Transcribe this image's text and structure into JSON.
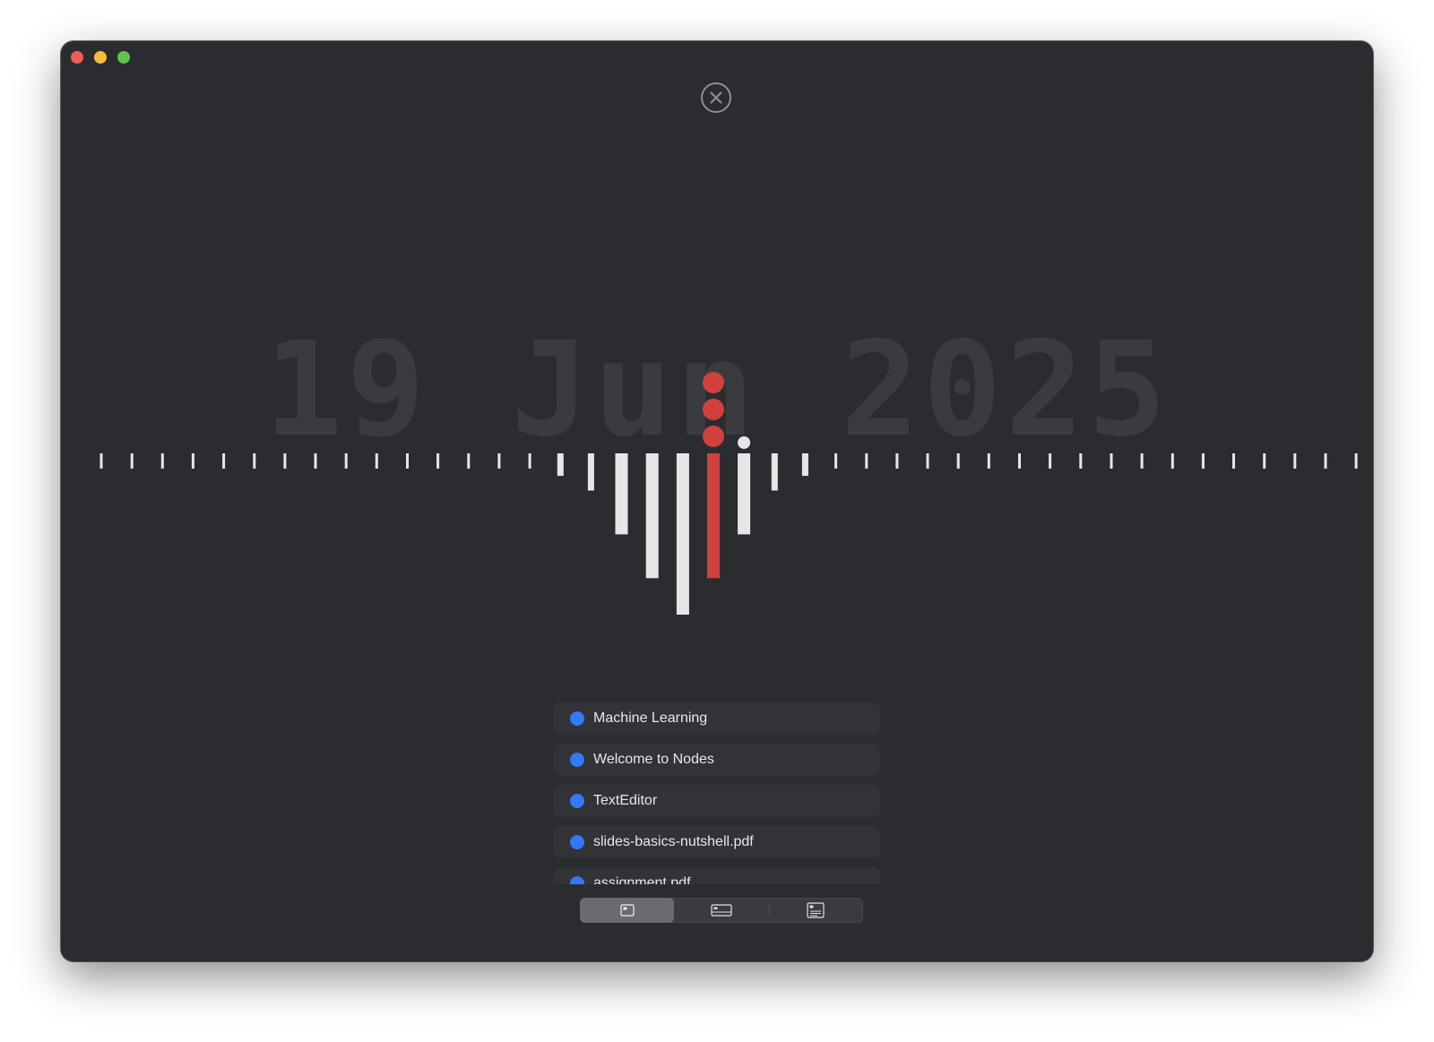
{
  "window": {
    "traffic_lights": [
      {
        "name": "close",
        "color": "#ee5d55"
      },
      {
        "name": "minimize",
        "color": "#f5bd3a"
      },
      {
        "name": "zoom",
        "color": "#5fc34a"
      }
    ]
  },
  "header": {
    "close_icon": "circle-x-icon"
  },
  "timeline": {
    "date_label": "19 Jun 2025",
    "tick_count": 42,
    "selected_index": 20,
    "selected_color": "#d0403d",
    "tick_color": "#e6e6e8",
    "activity_levels": [
      0,
      0,
      0,
      0,
      0,
      0,
      0,
      0,
      0,
      0,
      0,
      0,
      0,
      0,
      0,
      0.05,
      0.15,
      0.45,
      0.75,
      1.0,
      0.75,
      0.45,
      0.15,
      0.05,
      0,
      0,
      0,
      0,
      0,
      0,
      0,
      0,
      0,
      0,
      0,
      0,
      0,
      0,
      0,
      0,
      0,
      0
    ],
    "selected_marker_dots": 3,
    "hover_marker_index": 21
  },
  "items": [
    {
      "label": "Machine Learning",
      "color": "#3478f6"
    },
    {
      "label": "Welcome to Nodes",
      "color": "#3478f6"
    },
    {
      "label": "TextEditor",
      "color": "#3478f6"
    },
    {
      "label": "slides-basics-nutshell.pdf",
      "color": "#3478f6"
    },
    {
      "label": "assignment.pdf",
      "color": "#3478f6"
    }
  ],
  "view_modes": [
    {
      "icon": "small-card-view-icon",
      "active": true
    },
    {
      "icon": "wide-card-view-icon",
      "active": false
    },
    {
      "icon": "detail-card-view-icon",
      "active": false
    }
  ]
}
